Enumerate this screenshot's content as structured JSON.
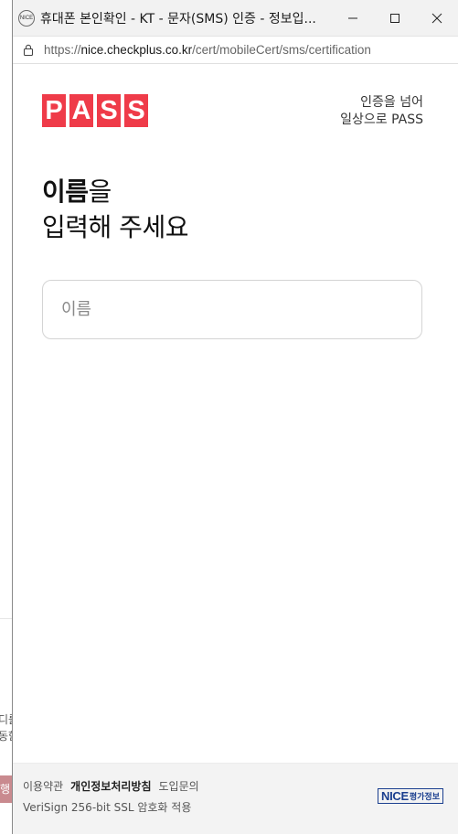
{
  "window": {
    "favicon_text": "NICE",
    "title": "휴대폰 본인확인 - KT - 문자(SMS) 인증 - 정보입..."
  },
  "urlbar": {
    "scheme": "https://",
    "host": "nice.checkplus.co.kr",
    "path": "/cert/mobileCert/sms/certification"
  },
  "brand": {
    "logo_letters": [
      "P",
      "A",
      "S",
      "S"
    ],
    "logo_color": "#ef3b49",
    "tagline_line1": "인증을 넘어",
    "tagline_line2": "일상으로 PASS"
  },
  "heading": {
    "bold": "이름",
    "rest_line1": "을",
    "line2": "입력해 주세요"
  },
  "name_input": {
    "placeholder": "이름",
    "value": ""
  },
  "footer": {
    "terms": "이용약관",
    "privacy": "개인정보처리방침",
    "inquiry": "도입문의",
    "ssl": "VeriSign 256-bit SSL 암호화 적용",
    "nice_logo": "NICE",
    "nice_logo_sub": "평가정보"
  },
  "background_page": {
    "frag1": "디를",
    "frag2": "동함",
    "frag3": "행"
  }
}
